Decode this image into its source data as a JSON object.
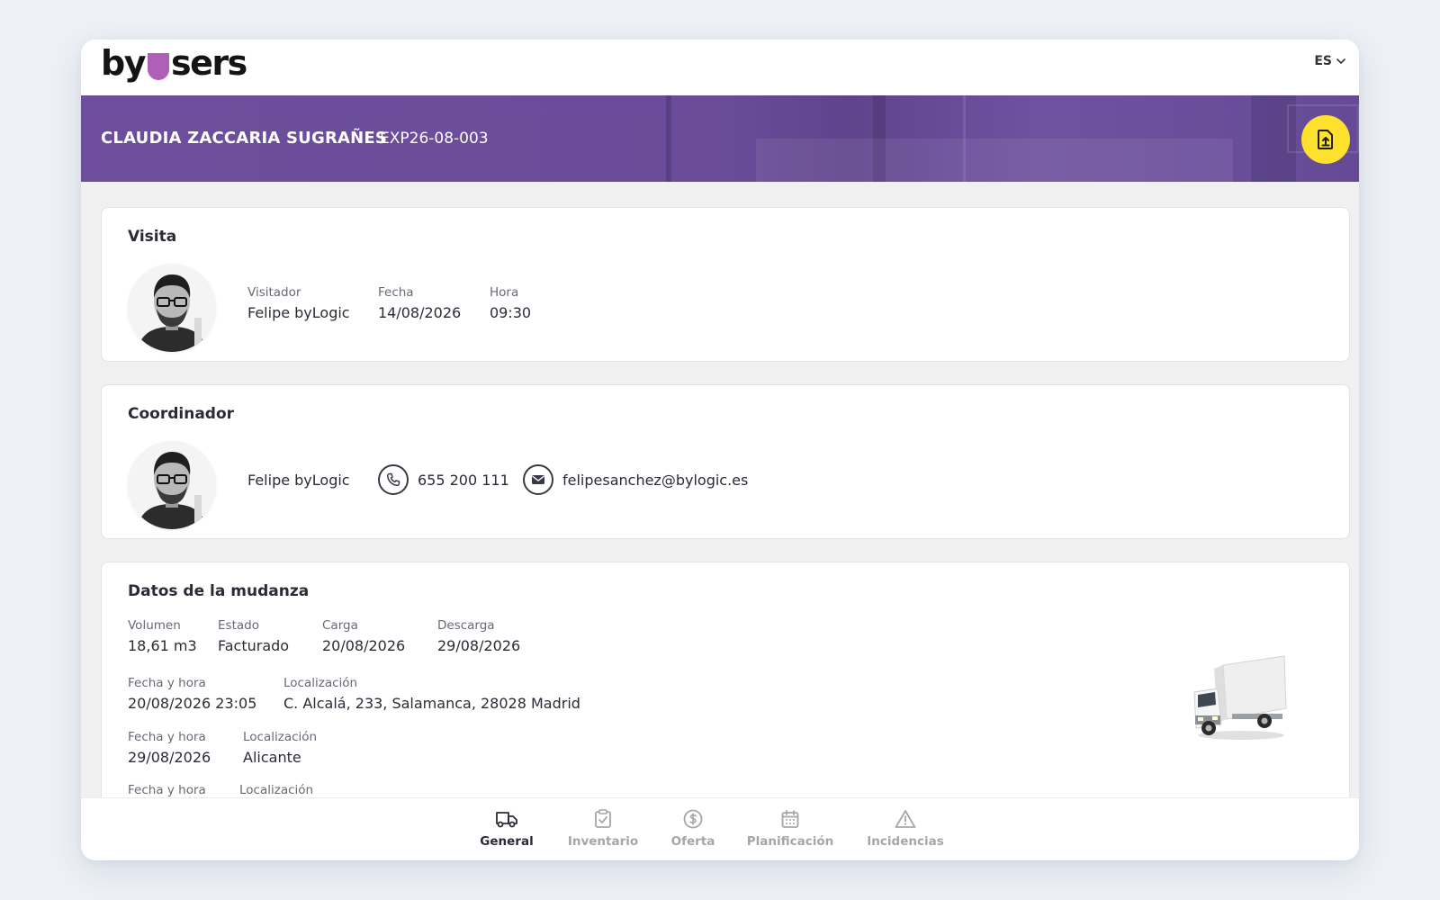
{
  "header": {
    "logo": {
      "text_left": "by",
      "text_right": "sers"
    },
    "language": "ES"
  },
  "banner": {
    "client_name": "CLAUDIA ZACCARIA SUGRAÑES",
    "expedient_code": "EXP26-08-003"
  },
  "visita": {
    "title": "Visita",
    "visitador_label": "Visitador",
    "visitador": "Felipe byLogic",
    "fecha_label": "Fecha",
    "fecha": "14/08/2026",
    "hora_label": "Hora",
    "hora": "09:30"
  },
  "coordinador": {
    "title": "Coordinador",
    "name": "Felipe byLogic",
    "phone": "655 200 111",
    "email": "felipesanchez@bylogic.es"
  },
  "mudanza": {
    "title": "Datos de la mudanza",
    "volumen_label": "Volumen",
    "volumen": "18,61 m3",
    "estado_label": "Estado",
    "estado": "Facturado",
    "carga_label": "Carga",
    "carga": "20/08/2026",
    "descarga_label": "Descarga",
    "descarga": "29/08/2026",
    "stops": [
      {
        "fecha_label": "Fecha y hora",
        "fecha": "20/08/2026 23:05",
        "loc_label": "Localización",
        "loc": "C. Alcalá, 233, Salamanca, 28028 Madrid"
      },
      {
        "fecha_label": "Fecha y hora",
        "fecha": "29/08/2026",
        "loc_label": "Localización",
        "loc": "Alicante"
      },
      {
        "fecha_label": "Fecha y hora",
        "fecha": "",
        "loc_label": "Localización",
        "loc": ""
      }
    ]
  },
  "nav": {
    "items": [
      {
        "label": "General",
        "icon": "truck-icon"
      },
      {
        "label": "Inventario",
        "icon": "clipboard-check-icon"
      },
      {
        "label": "Oferta",
        "icon": "dollar-icon"
      },
      {
        "label": "Planificación",
        "icon": "calendar-icon"
      },
      {
        "label": "Incidencias",
        "icon": "warning-icon"
      }
    ]
  },
  "colors": {
    "accent_purple": "#6c4e9c",
    "upload_yellow": "#fde12d",
    "logo_shield": "#b05fb8"
  }
}
